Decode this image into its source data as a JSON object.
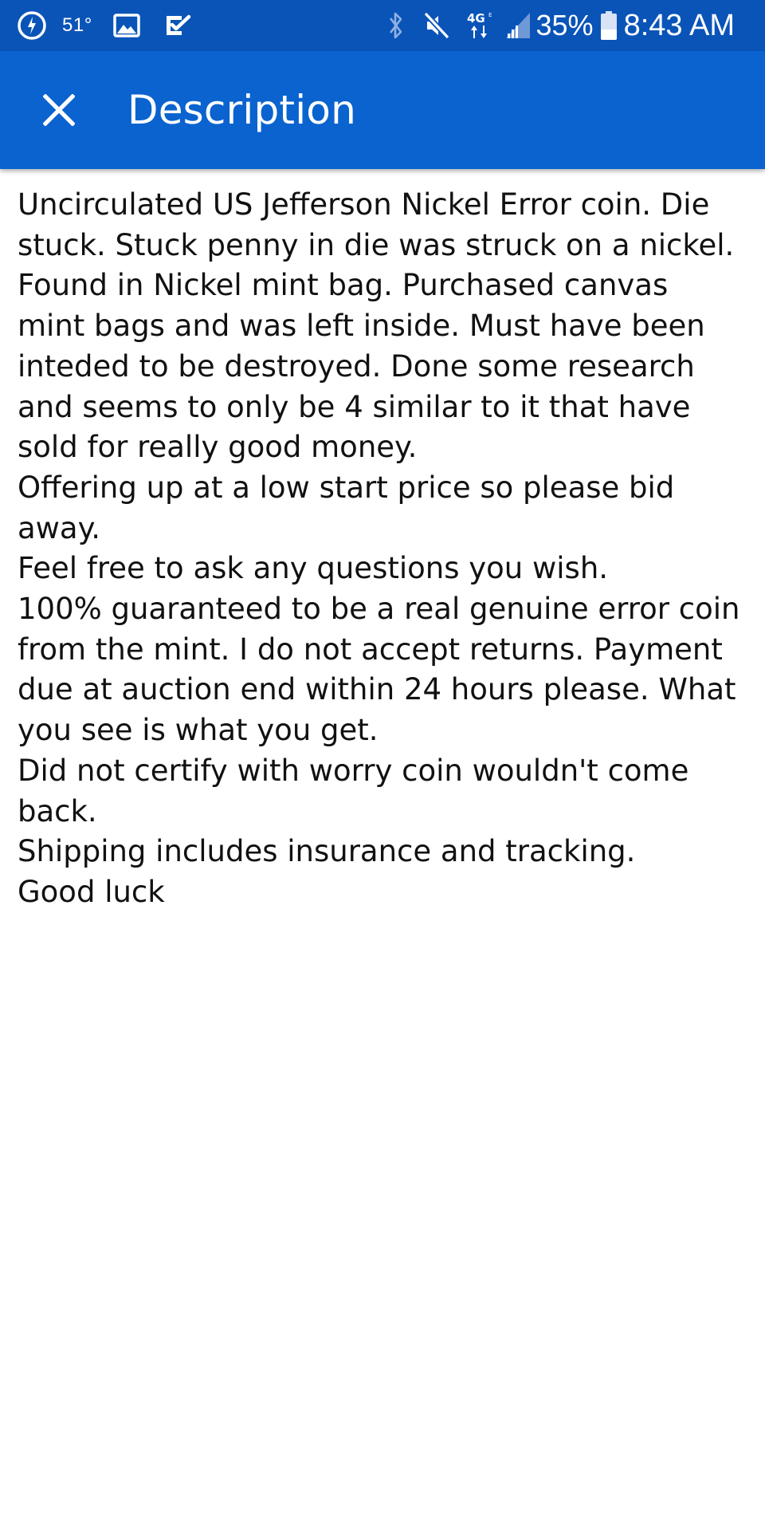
{
  "status_bar": {
    "weather_icon": "compass-clock-icon",
    "temperature": "51°",
    "gallery_icon": "image-icon",
    "check_icon": "tasks-check-icon",
    "bluetooth_icon": "bluetooth-icon",
    "mute_icon": "muted-speaker-icon",
    "network_type": "4G",
    "signal_icon": "signal-bars-icon",
    "battery_percent": "35%",
    "battery_icon": "battery-icon",
    "time": "8:43 AM",
    "color": "#0a54b8"
  },
  "app_bar": {
    "close_icon": "close-icon",
    "title": "Description",
    "color": "#0a63cf"
  },
  "description": {
    "lines": [
      "Uncirculated US Jefferson Nickel Error coin. Die",
      "stuck. Stuck penny in die was struck on a nickel.",
      "Found in Nickel mint bag. Purchased canvas",
      "mint bags and was left inside. Must have been",
      "inteded to be destroyed. Done some research",
      "and seems to only be 4 similar to it that have",
      "sold for really good money.",
      "Offering up at a low start price so please bid",
      "away.",
      "Feel free to ask any questions you wish.",
      "100% guaranteed to be a real genuine error coin",
      "from the mint. I do not accept returns. Payment",
      "due at auction end within 24 hours please. What",
      "you see is what you get.",
      "Did not certify with worry coin wouldn't come",
      "back.",
      "Shipping includes insurance and tracking.",
      "Good luck"
    ]
  }
}
